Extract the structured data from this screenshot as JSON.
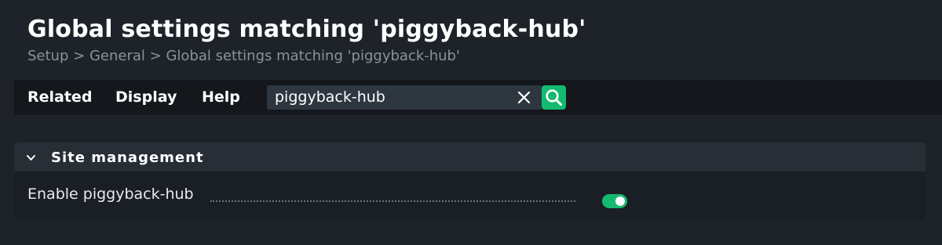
{
  "page": {
    "title": "Global settings matching 'piggyback-hub'"
  },
  "breadcrumb": {
    "items": [
      "Setup",
      "General",
      "Global settings matching 'piggyback-hub'"
    ],
    "separator": ">"
  },
  "menu": {
    "items": [
      "Related",
      "Display",
      "Help"
    ]
  },
  "search": {
    "value": "piggyback-hub",
    "clear_icon": "close-icon",
    "submit_icon": "search-icon"
  },
  "section": {
    "title": "Site management",
    "expanded": true,
    "settings": [
      {
        "label": "Enable piggyback-hub",
        "enabled": true
      }
    ]
  },
  "colors": {
    "accent": "#14ba6f",
    "background": "#1e232a",
    "toolbar": "#14181d",
    "panel_header": "#272e36"
  }
}
